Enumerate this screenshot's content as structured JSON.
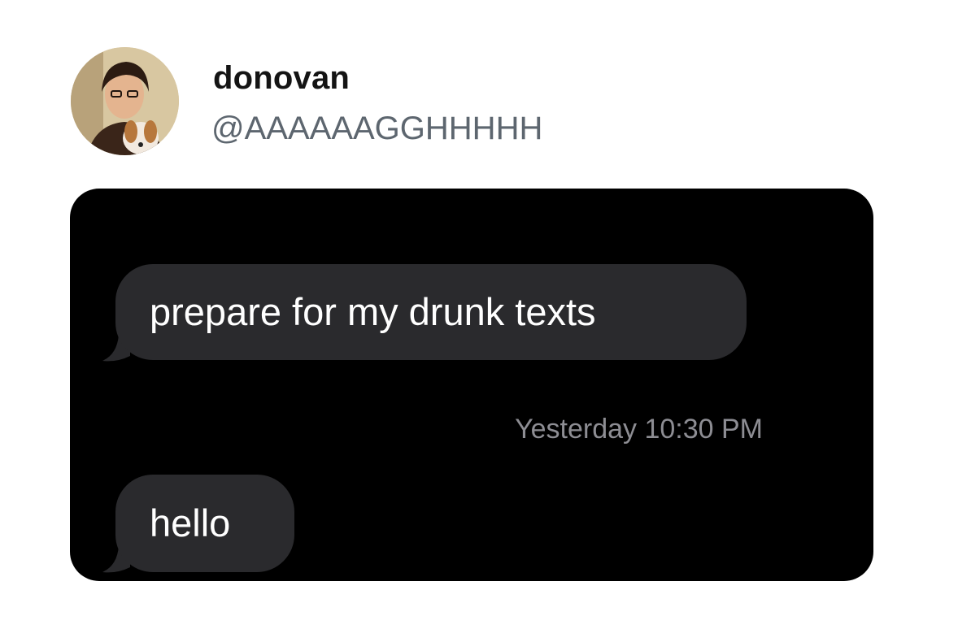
{
  "tweet": {
    "display_name": "donovan",
    "handle": "@AAAAAAGGHHHHH",
    "avatar_icon": "profile-photo-avatar"
  },
  "conversation": {
    "background_color": "#000000",
    "bubble_color": "#2a2a2d",
    "messages": [
      {
        "text": "prepare for my drunk texts"
      },
      {
        "text": "hello"
      }
    ],
    "timestamp": "Yesterday 10:30 PM"
  }
}
